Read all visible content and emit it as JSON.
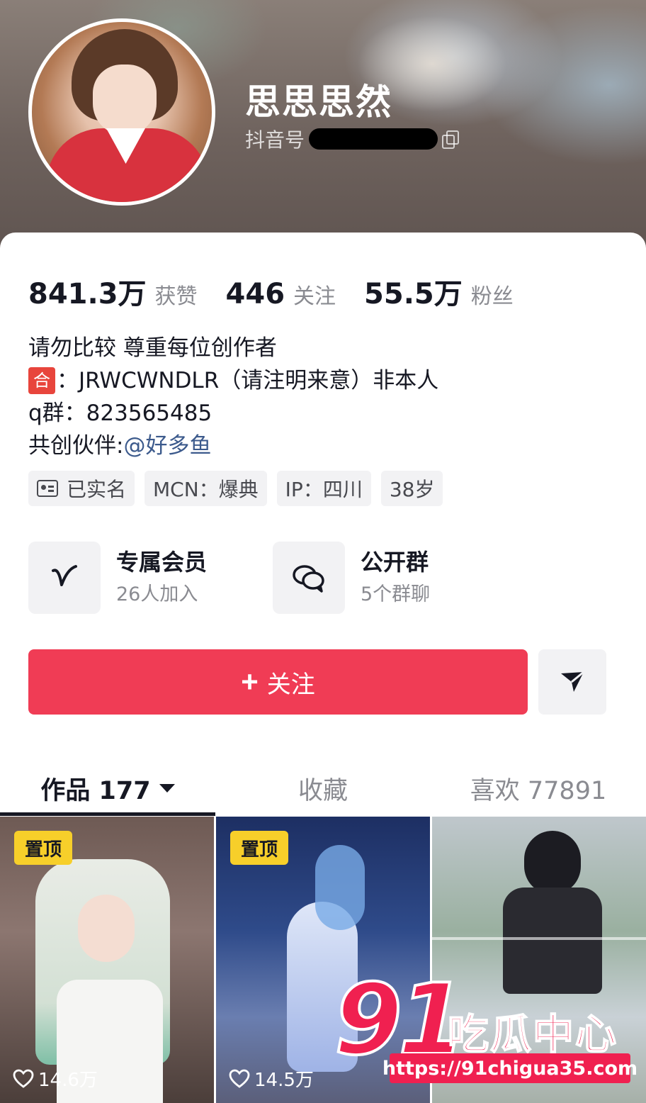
{
  "profile": {
    "nickname": "思思思然",
    "douyin_id_label": "抖音号"
  },
  "stats": [
    {
      "value": "841.3万",
      "label": "获赞"
    },
    {
      "value": "446",
      "label": "关注"
    },
    {
      "value": "55.5万",
      "label": "粉丝"
    }
  ],
  "bio": {
    "line1": "请勿比较 尊重每位创作者",
    "line2_badge": "合",
    "line2_text": "：JRWCWNDLR（请注明来意）非本人",
    "line3": "q群：823565485",
    "line4_prefix": "共创伙伴:",
    "line4_link": "@好多鱼"
  },
  "tags": {
    "verified": "已实名",
    "mcn": "MCN：爆典",
    "ip": "IP：四川",
    "age": "38岁"
  },
  "features": [
    {
      "title": "专属会员",
      "sub": "26人加入",
      "icon": "v-member-icon"
    },
    {
      "title": "公开群",
      "sub": "5个群聊",
      "icon": "chat-bubbles-icon"
    }
  ],
  "actions": {
    "follow_plus": "+",
    "follow_label": "关注",
    "share_icon": "send-icon"
  },
  "tabs": [
    {
      "label": "作品 177",
      "active": true
    },
    {
      "label": "收藏",
      "active": false
    },
    {
      "label": "喜欢 77891",
      "active": false
    }
  ],
  "videos": [
    {
      "pinned": "置顶",
      "likes": "14.6万"
    },
    {
      "pinned": "置顶",
      "likes": "14.5万"
    },
    {
      "pinned": "",
      "likes": ""
    }
  ],
  "watermark": {
    "big": "91",
    "text": "吃瓜中心",
    "url": "https://91chigua35.com"
  },
  "colors": {
    "follow_button": "#f03c55",
    "pin_badge": "#f7cf2a",
    "link": "#3c5a8c",
    "watermark": "#f02050"
  }
}
